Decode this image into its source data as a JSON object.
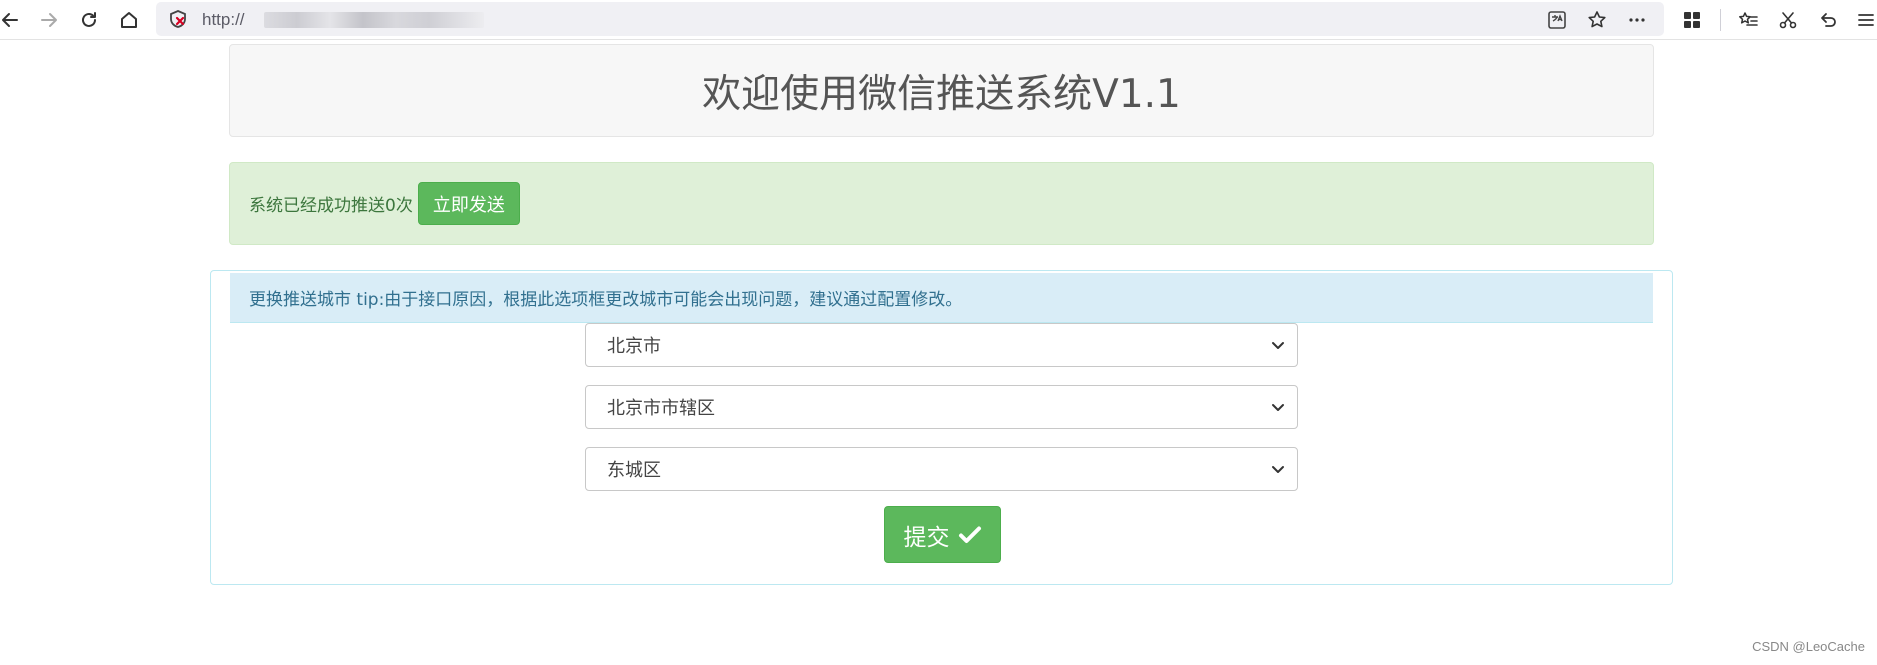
{
  "browser": {
    "url": "http://",
    "icons": [
      "back-icon",
      "forward-icon",
      "reload-icon",
      "home-icon",
      "shield-warning-icon",
      "translate-icon",
      "star-icon",
      "more-icon",
      "grid-icon",
      "favorites-icon",
      "screenshot-icon",
      "undo-icon",
      "menu-icon"
    ]
  },
  "header": {
    "title": "欢迎使用微信推送系统V1.1"
  },
  "status": {
    "message": "系统已经成功推送0次",
    "send_label": "立即发送"
  },
  "city_panel": {
    "heading": "更换推送城市 tip:由于接口原因，根据此选项框更改城市可能会出现问题，建议通过配置修改。",
    "province": "北京市",
    "city": "北京市市辖区",
    "district": "东城区",
    "submit_label": "提交"
  },
  "watermark": "CSDN @LeoCache",
  "colors": {
    "success": "#5cb85c",
    "alert_bg": "#dff0d8",
    "info_bg": "#d9edf7",
    "info_border": "#bce8f1"
  }
}
